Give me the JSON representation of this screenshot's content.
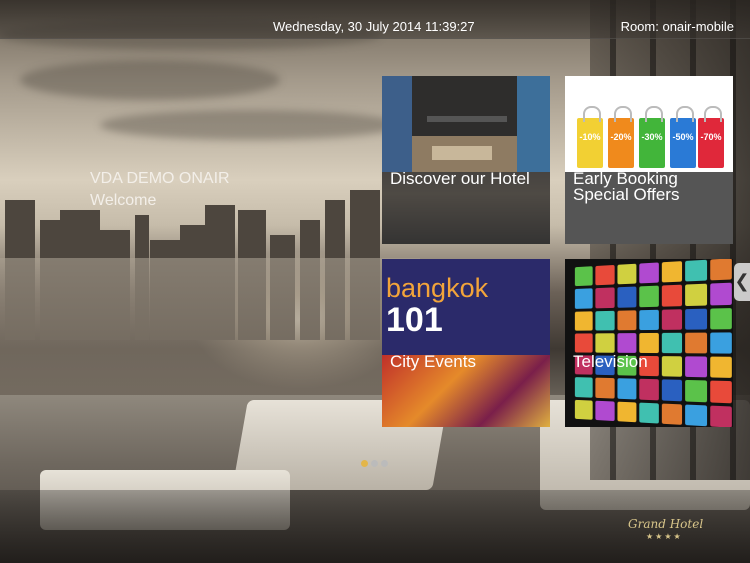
{
  "header": {
    "datetime": "Wednesday, 30 July 2014 11:39:27",
    "room": "Room: onair-mobile"
  },
  "welcome": {
    "line1": "VDA DEMO ONAIR",
    "line2": "Welcome"
  },
  "tiles": [
    {
      "label": "Discover our Hotel",
      "icon": "hotel-lobby-image"
    },
    {
      "label_line1": "Early Booking",
      "label_line2": "Special Offers",
      "icon": "shopping-bags-image",
      "bag_labels": [
        "-10%",
        "-20%",
        "-30%",
        "-50%",
        "-70%"
      ]
    },
    {
      "label": "City Events",
      "icon": "bangkok-101-cover-image",
      "cover_title": "bangkok",
      "cover_number": "101"
    },
    {
      "label": "Television",
      "icon": "tv-wall-image"
    }
  ],
  "pagination": {
    "count": 3,
    "active": 0
  },
  "side_handle": {
    "glyph": "❮"
  },
  "footer": {
    "brand": "Grand Hotel",
    "stars": "★★★★"
  },
  "colors": {
    "accent": "#e3b64a",
    "tile_caption": "#373737",
    "bags": [
      "#f2d033",
      "#f08a1c",
      "#42b53a",
      "#2a7ad6",
      "#e0283a"
    ]
  }
}
